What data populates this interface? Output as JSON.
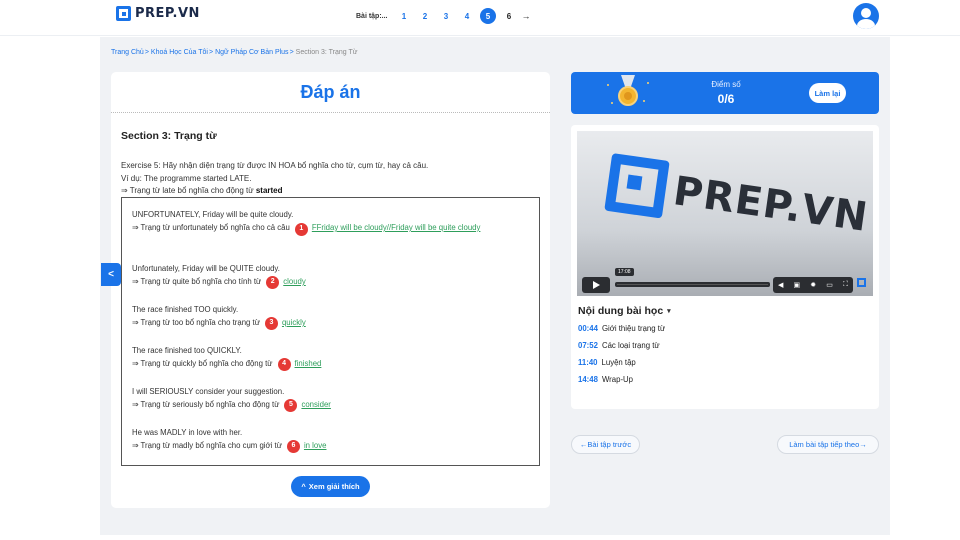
{
  "header": {
    "logo_text": "PREP.VN",
    "pager_label": "Bài tập:...",
    "pages": [
      "1",
      "2",
      "3",
      "4",
      "5",
      "6"
    ],
    "active_page": "5",
    "next_arrow": "→"
  },
  "breadcrumb": {
    "items": [
      "Trang Chủ",
      "Khoá Học Của Tôi",
      "Ngữ Pháp Cơ Bản Plus",
      "Section 3: Trạng Từ"
    ],
    "separator": ">"
  },
  "answer_card": {
    "title": "Đáp án",
    "section_title": "Section 3: Trạng từ",
    "exercise_line1": "Exercise 5: Hãy nhận diện trạng từ được IN HOA bổ nghĩa cho từ, cụm từ, hay cả câu.",
    "exercise_line2": "Ví dụ: The programme started LATE.",
    "exercise_line3_prefix": "⇒ Trạng từ late bổ nghĩa cho động từ ",
    "exercise_line3_bold": "started",
    "items": [
      {
        "question": "UNFORTUNATELY, Friday will be quite cloudy.",
        "explanation": "⇒ Trạng từ unfortunately bổ nghĩa cho cả câu",
        "number": "1",
        "answer": "FFriday will be cloudy//Friday will be quite cloudy"
      },
      {
        "question": "Unfortunately, Friday will be QUITE cloudy.",
        "explanation": "⇒ Trạng từ quite bổ nghĩa cho tính từ",
        "number": "2",
        "answer": "cloudy"
      },
      {
        "question": "The race finished TOO quickly.",
        "explanation": "⇒ Trạng từ too bổ nghĩa cho trạng từ",
        "number": "3",
        "answer": "quickly"
      },
      {
        "question": "The race finished too QUICKLY.",
        "explanation": "⇒ Trạng từ quickly bổ nghĩa cho động từ",
        "number": "4",
        "answer": "finished"
      },
      {
        "question": "I will SERIOUSLY consider your suggestion.",
        "explanation": "⇒ Trạng từ seriously bổ nghĩa cho động từ",
        "number": "5",
        "answer": "consider"
      },
      {
        "question": "He was MADLY in love with her.",
        "explanation": "⇒ Trạng từ madly bổ nghĩa cho cụm giới từ",
        "number": "6",
        "answer": "in love"
      }
    ],
    "solution_button": "Xem giải thích",
    "solution_icon": "^",
    "collapse_icon": "<"
  },
  "score": {
    "label": "Điểm số",
    "value": "0/6",
    "retry_button": "Làm lại"
  },
  "video": {
    "brand_text": "PREP.VN",
    "time_tooltip": "17:08",
    "toc_title": "Nội dung bài học",
    "toc_caret": "▾",
    "toc": [
      {
        "time": "00:44",
        "label": "Giới thiệu trạng từ"
      },
      {
        "time": "07:52",
        "label": "Các loại trạng từ"
      },
      {
        "time": "11:40",
        "label": "Luyện tập"
      },
      {
        "time": "14:48",
        "label": "Wrap-Up"
      }
    ]
  },
  "nav": {
    "prev": "←Bài tập trước",
    "next": "Làm bài tập tiếp theo→"
  },
  "colors": {
    "accent": "#1a73e8",
    "badge": "#e53935",
    "answer": "#2e9e5b",
    "background": "#f0f2f5"
  }
}
